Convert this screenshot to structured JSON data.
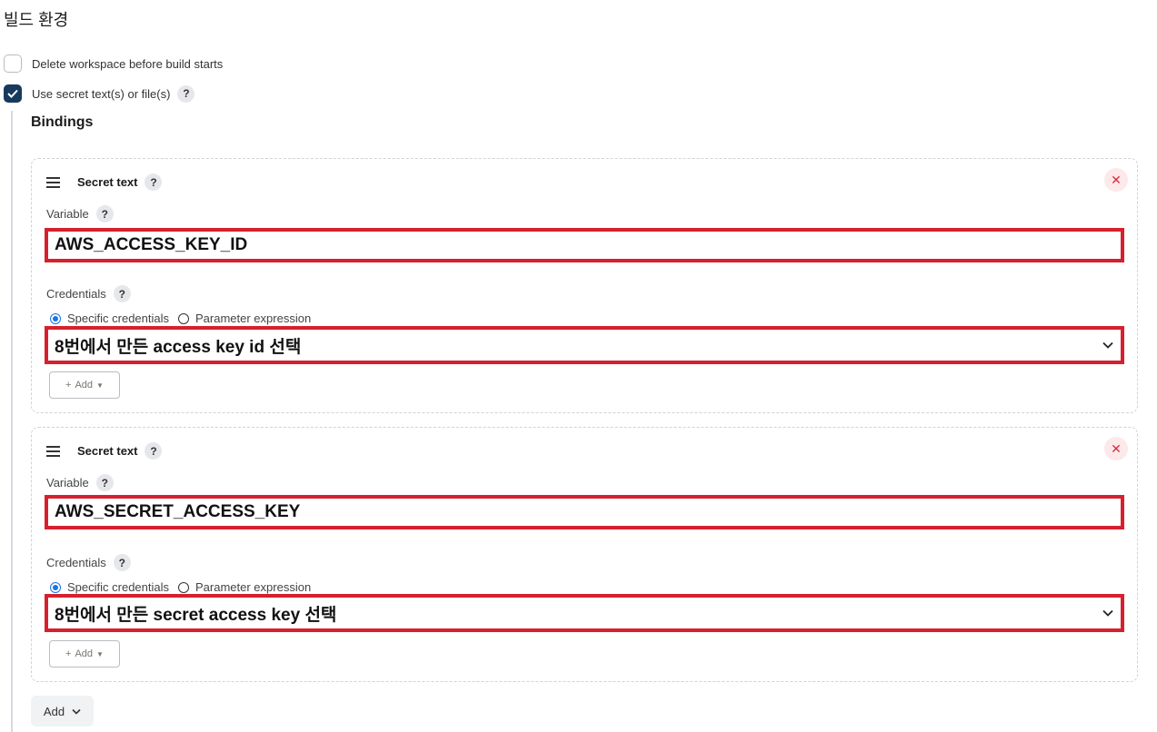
{
  "section": {
    "title": "빌드 환경"
  },
  "options": [
    {
      "label": "Delete workspace before build starts",
      "checked": false
    },
    {
      "label": "Use secret text(s) or file(s)",
      "checked": true,
      "help": "?"
    }
  ],
  "bindings": {
    "title": "Bindings",
    "items": [
      {
        "type_label": "Secret text",
        "help": "?",
        "close": "✕",
        "variable_label": "Variable",
        "variable_value": "AWS_ACCESS_KEY_ID",
        "credentials_label": "Credentials",
        "radio_specific": "Specific credentials",
        "radio_param": "Parameter expression",
        "selected_radio": "specific",
        "credentials_value": "8번에서 만든 access key id 선택",
        "add_label": "Add"
      },
      {
        "type_label": "Secret text",
        "help": "?",
        "close": "✕",
        "variable_label": "Variable",
        "variable_value": "AWS_SECRET_ACCESS_KEY",
        "credentials_label": "Credentials",
        "radio_specific": "Specific credentials",
        "radio_param": "Parameter expression",
        "selected_radio": "specific",
        "credentials_value": "8번에서 만든 secret access key 선택",
        "add_label": "Add"
      }
    ]
  },
  "add_button": {
    "label": "Add"
  },
  "colors": {
    "checkbox_checked": "#173a5c",
    "highlight": "#d6202e",
    "radio_on": "#1a73e8",
    "close": "#d22e3b"
  },
  "icons": [
    "check-icon",
    "help-icon",
    "drag-handle-icon",
    "close-icon",
    "chevron-down-icon",
    "plus-icon",
    "caret-down-icon"
  ]
}
